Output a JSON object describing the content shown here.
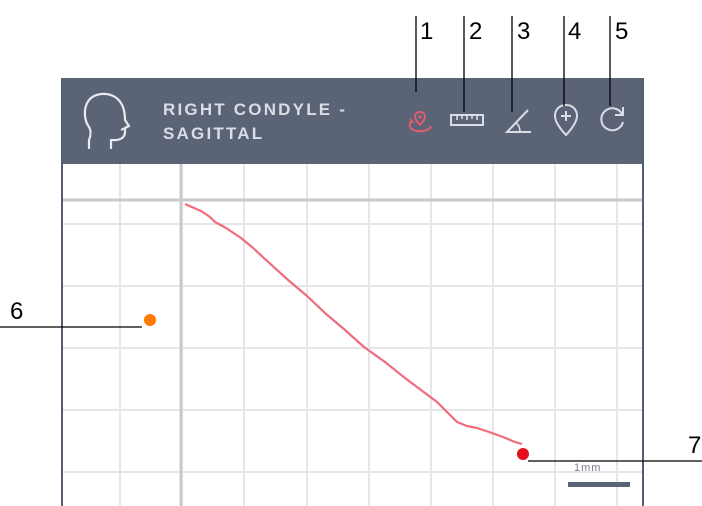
{
  "header": {
    "title_line1": "RIGHT CONDYLE -",
    "title_line2": "SAGITTAL"
  },
  "toolbar": {
    "tools": [
      {
        "name": "trace-tool-icon",
        "color": "#e05c6e"
      },
      {
        "name": "ruler-icon",
        "color": "#d9dde6"
      },
      {
        "name": "angle-icon",
        "color": "#d9dde6"
      },
      {
        "name": "add-point-icon",
        "color": "#d9dde6"
      },
      {
        "name": "refresh-icon",
        "color": "#d9dde6"
      }
    ]
  },
  "callouts": [
    "1",
    "2",
    "3",
    "4",
    "5",
    "6",
    "7"
  ],
  "plot": {
    "scale_label": "1mm",
    "trace_color": "#f06b7c",
    "start_point_color": "#ff7a00",
    "end_point_color": "#e5101e",
    "grid_color": "#e6e6e6",
    "axis_color": "#c9c9cc"
  }
}
